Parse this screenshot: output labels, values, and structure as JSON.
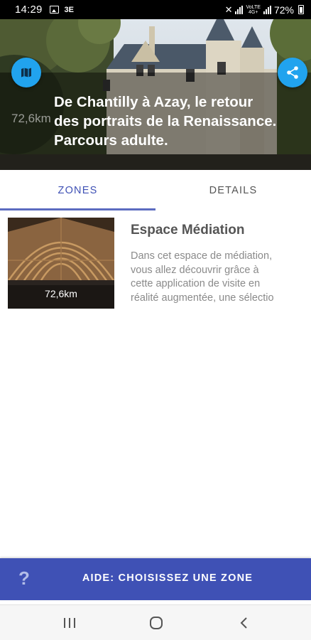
{
  "status_bar": {
    "time": "14:29",
    "battery": "72%",
    "network": "4G+",
    "volte": "VoLTE",
    "app_badge": "3E"
  },
  "hero": {
    "title_lines": [
      "De Chantilly à Azay, le retour",
      "des portraits de la Renaissance.",
      "Parcours adulte."
    ],
    "distance": "72,6km",
    "map_button_icon": "map-icon",
    "share_button_icon": "share-icon"
  },
  "tabs": {
    "zones": "ZONES",
    "details": "DETAILS",
    "active": "zones"
  },
  "zones": [
    {
      "title": "Espace Médiation",
      "distance": "72,6km",
      "description_lines": [
        "Dans cet espace de médiation,",
        "vous allez découvrir grâce à",
        "cette application de visite en",
        "réalité augmentée, une sélectio"
      ]
    }
  ],
  "help": {
    "icon": "?",
    "label": "AIDE: CHOISISSEZ UNE ZONE"
  },
  "colors": {
    "primary": "#3f51b5",
    "fab": "#21a3ee",
    "tab_indicator": "#5c6bc0"
  }
}
